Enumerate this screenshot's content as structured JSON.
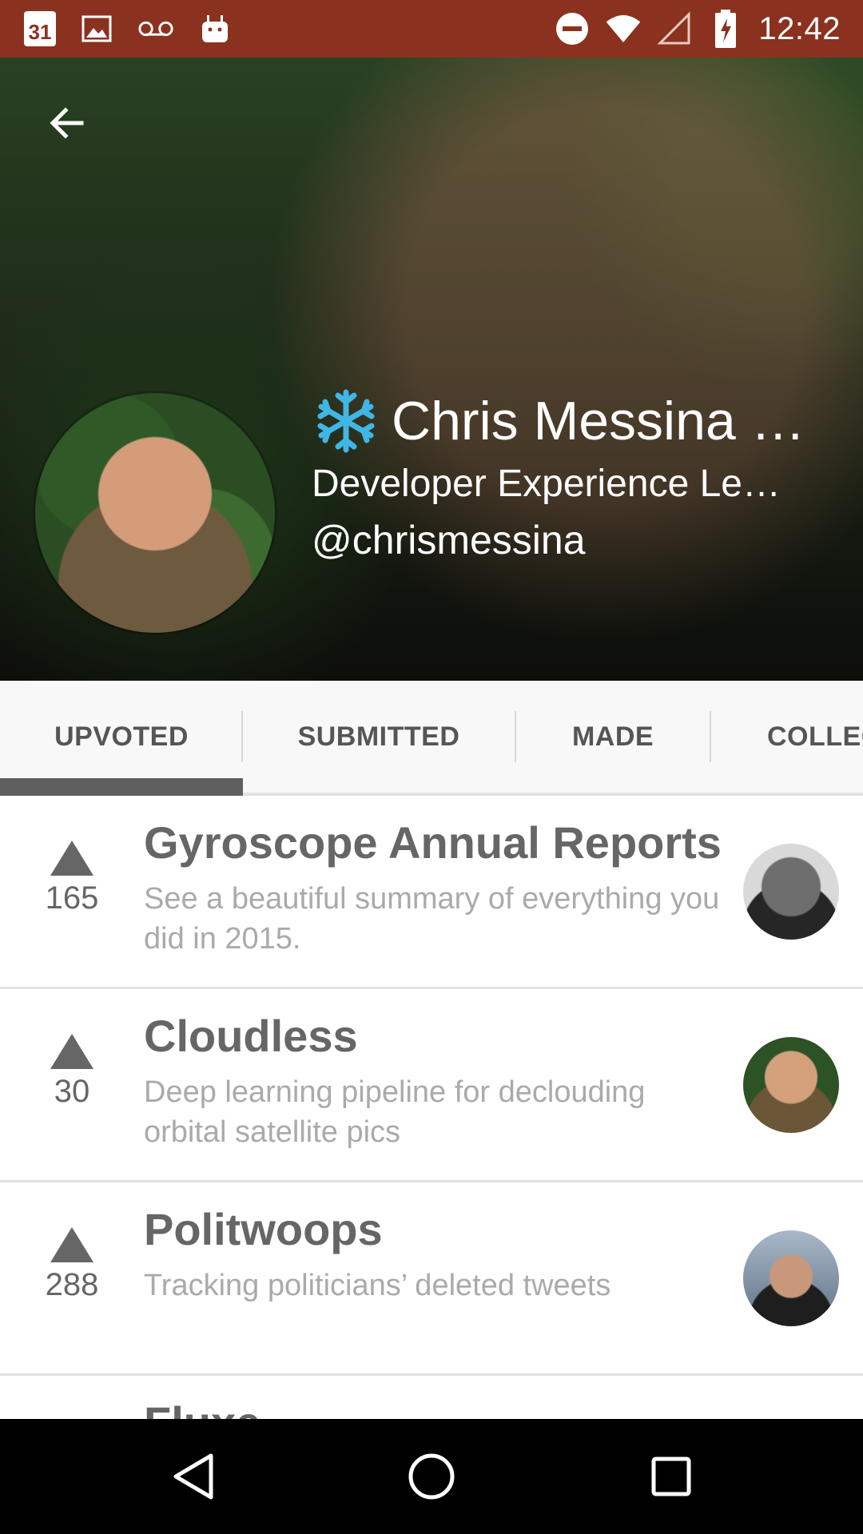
{
  "status_bar": {
    "calendar_day": "31",
    "time": "12:42",
    "left_icons": [
      "calendar-icon",
      "gallery-icon",
      "voicemail-icon",
      "android-icon"
    ],
    "right_icons": [
      "do-not-disturb-icon",
      "wifi-icon",
      "signal-icon",
      "battery-charging-icon"
    ]
  },
  "header": {
    "back_icon": "arrow-back-icon",
    "name": "Chris Messina …",
    "title": "Developer Experience Le…",
    "handle": "@chrismessina",
    "badge_icon": "snowflake-icon"
  },
  "tabs": [
    {
      "label": "UPVOTED",
      "selected": true
    },
    {
      "label": "SUBMITTED",
      "selected": false
    },
    {
      "label": "MADE",
      "selected": false
    },
    {
      "label": "COLLEC",
      "selected": false
    }
  ],
  "posts": [
    {
      "votes": "165",
      "title": "Gyroscope Annual Reports",
      "description": "See a beautiful summary of everything you did in 2015."
    },
    {
      "votes": "30",
      "title": "Cloudless",
      "description": "Deep learning pipeline for declouding orbital satellite pics"
    },
    {
      "votes": "288",
      "title": "Politwoops",
      "description": "Tracking politicians’ deleted tweets"
    },
    {
      "title": "Fluxe"
    }
  ],
  "nav": {
    "back": "back-triangle-icon",
    "home": "home-circle-icon",
    "recents": "recents-square-icon"
  },
  "colors": {
    "status_bar": "#8a321f",
    "tab_text": "#555555",
    "vote": "#666666",
    "description": "#aaaaaa"
  }
}
